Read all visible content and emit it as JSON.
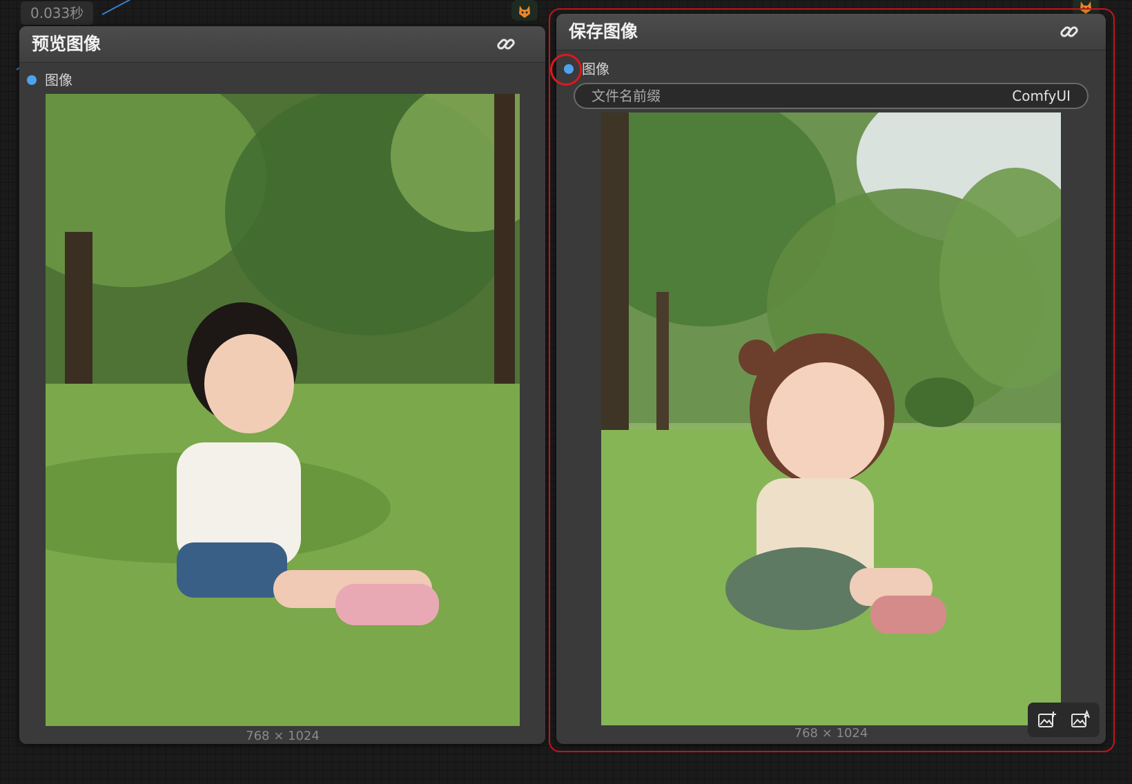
{
  "execution_time": "0.033秒",
  "preview_node": {
    "title": "预览图像",
    "input_slot": "图像",
    "image_dims": "768 × 1024"
  },
  "save_node": {
    "title": "保存图像",
    "input_slot": "图像",
    "filename_prefix": {
      "label": "文件名前缀",
      "value": "ComfyUI"
    },
    "image_dims": "768 × 1024"
  },
  "colors": {
    "canvas": "#1b1b1b",
    "node_body": "#3a3a3a",
    "slot_dot": "#4ea3f0",
    "selection": "#c8141e"
  },
  "icons": {
    "node_link": "link-icon",
    "node_badge": "fox-badge-icon",
    "toolbar": [
      "add-image-icon",
      "image-text-icon"
    ]
  }
}
